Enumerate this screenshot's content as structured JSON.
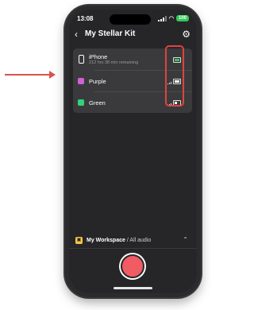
{
  "status_bar": {
    "time": "13:08",
    "location_icon": "location-arrow-icon",
    "signal_icon": "cellular-signal-icon",
    "wifi_icon": "wifi-icon",
    "battery_label": "100"
  },
  "header": {
    "back_icon": "chevron-left-icon",
    "title": "My Stellar Kit",
    "settings_icon": "gear-icon"
  },
  "devices": [
    {
      "name": "iPhone",
      "subtitle": "212 hrs 38 min remaining",
      "icon": "phone-icon",
      "battery_level": 1.0,
      "battery_color": "#34c759"
    },
    {
      "name": "Purple",
      "color": "#d35fd8",
      "signal_icon": "signal-icon",
      "battery_level": 0.9
    },
    {
      "name": "Green",
      "color": "#34d17b",
      "signal_icon": "signal-icon",
      "battery_level": 0.4
    }
  ],
  "workspace": {
    "name": "My Workspace",
    "scope": "/ All audio",
    "chevron": "chevron-up-icon"
  },
  "record": {
    "icon": "record-icon",
    "color": "#f15b63"
  },
  "annotation": {
    "highlight_color": "#e0433f"
  }
}
